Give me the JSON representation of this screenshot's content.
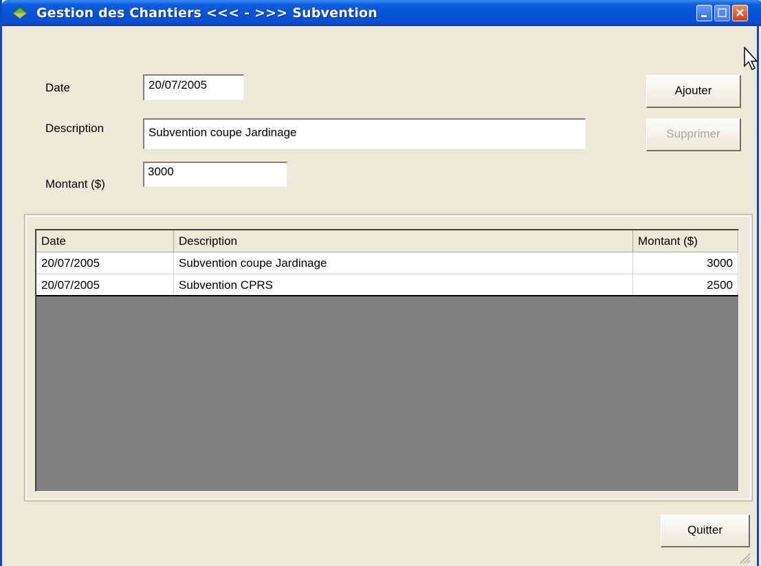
{
  "window": {
    "title": "Gestion des Chantiers <<< - >>> Subvention"
  },
  "form": {
    "date_label": "Date",
    "date_value": "20/07/2005",
    "description_label": "Description",
    "description_value": "Subvention coupe Jardinage",
    "amount_label": "Montant ($)",
    "amount_value": "3000"
  },
  "buttons": {
    "add": "Ajouter",
    "delete": "Supprimer",
    "quit": "Quitter"
  },
  "table": {
    "columns": [
      "Date",
      "Description",
      "Montant ($)"
    ],
    "rows": [
      {
        "date": "20/07/2005",
        "description": "Subvention coupe Jardinage",
        "amount": "3000"
      },
      {
        "date": "20/07/2005",
        "description": "Subvention CPRS",
        "amount": "2500"
      }
    ]
  },
  "colors": {
    "titlebar": "#0653d6",
    "window_bg": "#ece9d8",
    "grid_empty": "#808080"
  }
}
